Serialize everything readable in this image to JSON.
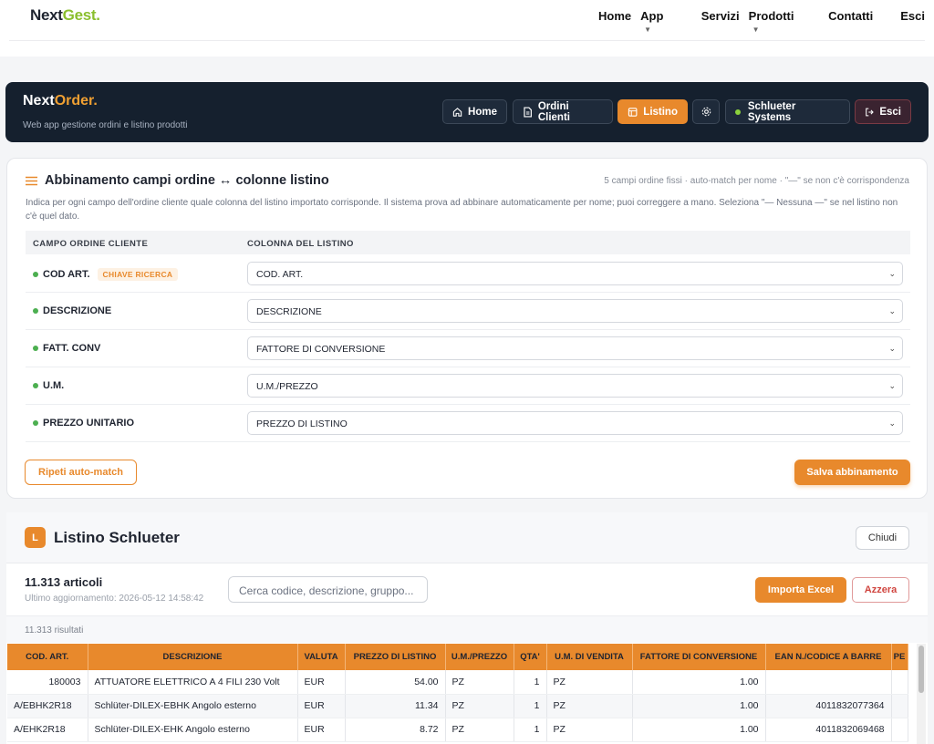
{
  "site": {
    "logo_a": "Next",
    "logo_b": "Gest.",
    "menu": [
      "Home",
      "App",
      "Servizi",
      "Prodotti",
      "Contatti",
      "Esci"
    ]
  },
  "app": {
    "logo_a": "Next",
    "logo_b": "Order.",
    "subtitle": "Web app gestione ordini e listino prodotti",
    "nav": {
      "home": "Home",
      "orders": "Ordini Clienti",
      "listino": "Listino",
      "supplier": "Schlueter Systems",
      "exit": "Esci"
    }
  },
  "mapping": {
    "title": "Abbinamento campi ordine ↔ colonne listino",
    "hint": "5 campi ordine fissi · auto-match per nome · \"—\" se non c'è corrispondenza",
    "description": "Indica per ogni campo dell'ordine cliente quale colonna del listino importato corrisponde. Il sistema prova ad abbinare automaticamente per nome; puoi correggere a mano. Seleziona \"— Nessuna —\" se nel listino non c'è quel dato.",
    "col_field": "CAMPO ORDINE CLIENTE",
    "col_column": "COLONNA DEL LISTINO",
    "key_badge": "CHIAVE RICERCA",
    "rows": [
      {
        "field": "COD ART.",
        "column": "COD. ART."
      },
      {
        "field": "DESCRIZIONE",
        "column": "DESCRIZIONE"
      },
      {
        "field": "FATT. CONV",
        "column": "FATTORE DI CONVERSIONE"
      },
      {
        "field": "U.M.",
        "column": "U.M./PREZZO"
      },
      {
        "field": "PREZZO UNITARIO",
        "column": "PREZZO DI LISTINO"
      }
    ],
    "btn_rematch": "Ripeti auto-match",
    "btn_save": "Salva abbinamento"
  },
  "listino": {
    "icon_letter": "L",
    "title": "Listino Schlueter",
    "close": "Chiudi",
    "count": "11.313 articoli",
    "updated": "Ultimo aggiornamento: 2026-05-12 14:58:42",
    "search_placeholder": "Cerca codice, descrizione, gruppo...",
    "btn_import": "Importa Excel",
    "btn_reset": "Azzera",
    "results": "11.313 risultati",
    "columns": [
      "COD. ART.",
      "DESCRIZIONE",
      "VALUTA",
      "PREZZO DI LISTINO",
      "U.M./PREZZO",
      "QTA'",
      "U.M. DI VENDITA",
      "FATTORE DI CONVERSIONE",
      "EAN N./CODICE A BARRE",
      "PE"
    ],
    "rows": [
      [
        "180003",
        "ATTUATORE ELETTRICO A 4 FILI 230 Volt",
        "EUR",
        "54.00",
        "PZ",
        "1",
        "PZ",
        "1.00",
        "",
        ""
      ],
      [
        "A/EBHK2R18",
        "Schlüter-DILEX-EBHK Angolo esterno",
        "EUR",
        "11.34",
        "PZ",
        "1",
        "PZ",
        "1.00",
        "4011832077364",
        ""
      ],
      [
        "A/EHK2R18",
        "Schlüter-DILEX-EHK Angolo esterno",
        "EUR",
        "8.72",
        "PZ",
        "1",
        "PZ",
        "1.00",
        "4011832069468",
        ""
      ]
    ]
  }
}
